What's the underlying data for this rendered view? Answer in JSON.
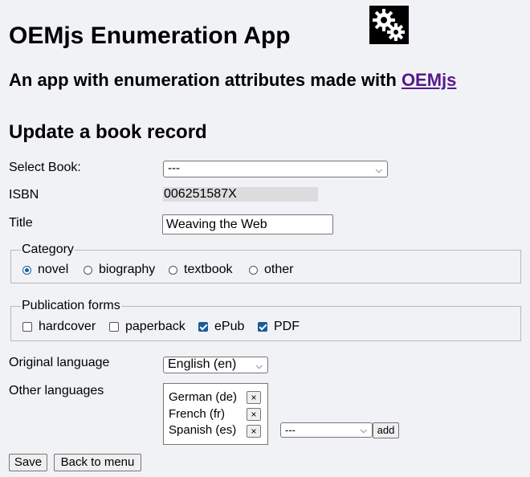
{
  "header": {
    "app_title": "OEMjs Enumeration App",
    "subtitle_prefix": "An app with enumeration attributes made with ",
    "subtitle_link": "OEMjs",
    "logo_icon": "gears-icon"
  },
  "form": {
    "title": "Update a book record",
    "select_book": {
      "label": "Select Book:",
      "value": "---"
    },
    "isbn": {
      "label": "ISBN",
      "value": "006251587X"
    },
    "title_field": {
      "label": "Title",
      "value": "Weaving the Web"
    },
    "category": {
      "legend": "Category",
      "options": [
        "novel",
        "biography",
        "textbook",
        "other"
      ],
      "selected": "novel"
    },
    "publication_forms": {
      "legend": "Publication forms",
      "options": [
        "hardcover",
        "paperback",
        "ePub",
        "PDF"
      ],
      "checked": [
        false,
        false,
        true,
        true
      ]
    },
    "original_language": {
      "label": "Original language",
      "value": "English (en)"
    },
    "other_languages": {
      "label": "Other languages",
      "items": [
        "German (de)",
        "French (fr)",
        "Spanish (es)"
      ],
      "remove_label": "×",
      "add_select_value": "---",
      "add_label": "add"
    },
    "save_label": "Save",
    "back_label": "Back to menu"
  },
  "colors": {
    "link": "#551a8b",
    "accent": "#1a5c96",
    "background": "#f1f2f5"
  }
}
